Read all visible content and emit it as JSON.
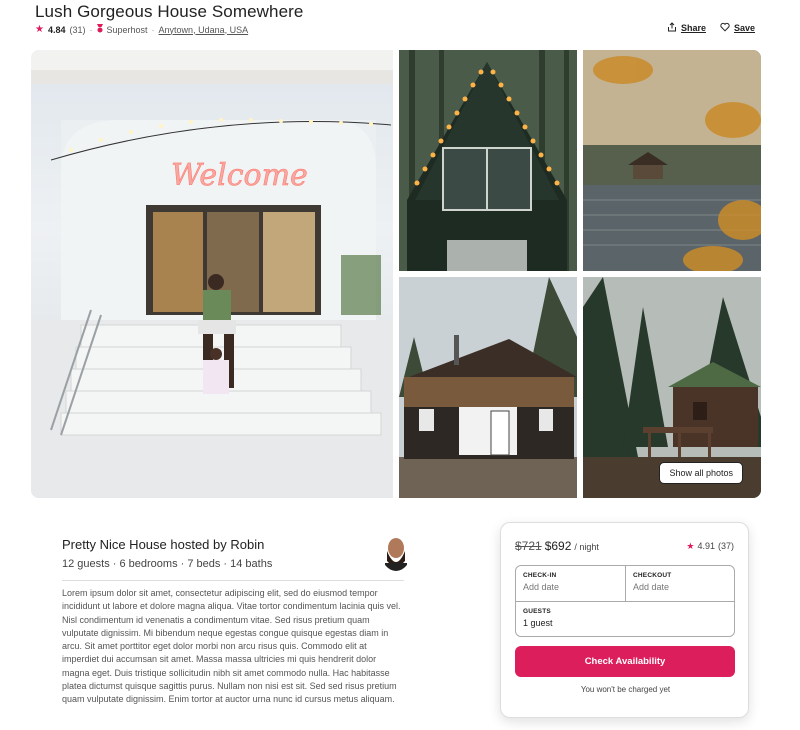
{
  "listing": {
    "title": "Lush Gorgeous House Somewhere",
    "rating": "4.84",
    "reviews": "(31)",
    "badge": "Superhost",
    "location": "Anytown, Udana, USA"
  },
  "actions": {
    "share": "Share",
    "save": "Save"
  },
  "gallery": {
    "main_sign": "Welcome",
    "show_all": "Show all photos"
  },
  "host": {
    "title": "Pretty Nice House hosted by Robin",
    "summary": "12 guests · 6 bedrooms · 7 beds · 14 baths",
    "description": "Lorem ipsum dolor sit amet, consectetur adipiscing elit, sed do eiusmod tempor incididunt ut labore et dolore magna aliqua. Vitae tortor condimentum lacinia quis vel. Nisl condimentum id venenatis a condimentum vitae. Sed risus pretium quam vulputate dignissim. Mi bibendum neque egestas congue quisque egestas diam in arcu. Sit amet porttitor eget dolor morbi non arcu risus quis. Commodo elit at imperdiet dui accumsan sit amet. Massa massa ultricies mi quis hendrerit dolor magna eget. Duis tristique sollicitudin nibh sit amet commodo nulla. Hac habitasse platea dictumst quisque sagittis purus. Nullam non nisi est sit. Sed sed risus pretium quam vulputate dignissim. Enim tortor at auctor urna nunc id cursus metus aliquam."
  },
  "booking": {
    "old_price": "$721",
    "price": "$692",
    "unit": "/ night",
    "rating": "4.91",
    "reviews": "(37)",
    "checkin_label": "CHECK-IN",
    "checkin_placeholder": "Add date",
    "checkout_label": "CHECKOUT",
    "checkout_placeholder": "Add date",
    "guests_label": "GUESTS",
    "guests_value": "1 guest",
    "button": "Check Availability",
    "note": "You won't be charged yet"
  },
  "colors": {
    "accent": "#dc1e5c",
    "star": "#e01a5a"
  },
  "icons": [
    "star-icon",
    "medal-icon",
    "share-icon",
    "heart-icon"
  ]
}
